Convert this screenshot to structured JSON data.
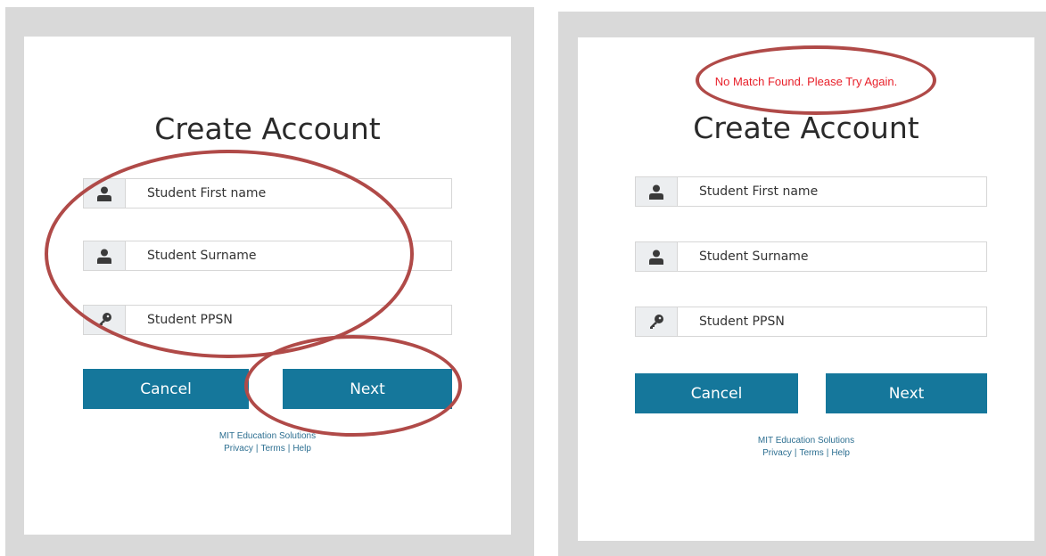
{
  "left_form": {
    "title": "Create Account",
    "fields": [
      {
        "placeholder": "Student First name",
        "icon": "user-icon"
      },
      {
        "placeholder": "Student Surname",
        "icon": "user-icon"
      },
      {
        "placeholder": "Student PPSN",
        "icon": "key-icon"
      }
    ],
    "cancel_label": "Cancel",
    "next_label": "Next",
    "footer": {
      "company": "MIT Education Solutions",
      "privacy": "Privacy",
      "terms": "Terms",
      "help": "Help",
      "separator": "|"
    }
  },
  "right_form": {
    "error": "No Match Found. Please Try Again.",
    "title": "Create Account",
    "fields": [
      {
        "placeholder": "Student First name",
        "icon": "user-icon"
      },
      {
        "placeholder": "Student Surname",
        "icon": "user-icon"
      },
      {
        "placeholder": "Student PPSN",
        "icon": "key-icon"
      }
    ],
    "cancel_label": "Cancel",
    "next_label": "Next",
    "footer": {
      "company": "MIT Education Solutions",
      "privacy": "Privacy",
      "terms": "Terms",
      "help": "Help",
      "separator": "|"
    }
  },
  "colors": {
    "button": "#15779b",
    "error": "#e8202a",
    "annotation": "#b04a48",
    "panel": "#d9d9d9"
  }
}
